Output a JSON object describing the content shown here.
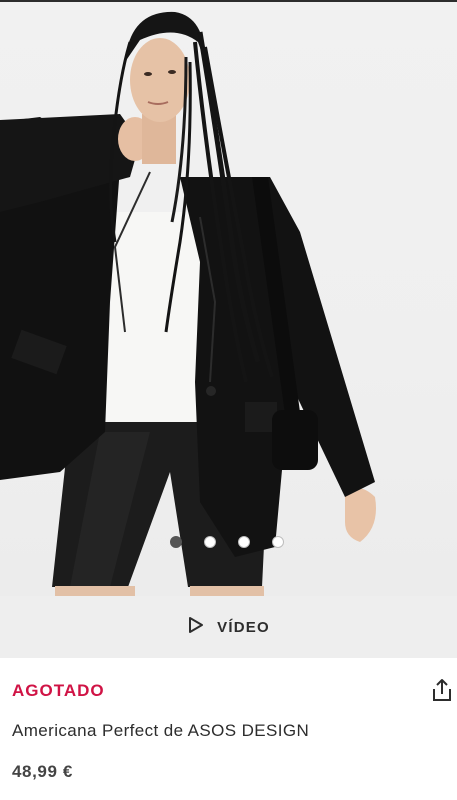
{
  "product": {
    "status": "AGOTADO",
    "title": "Americana Perfect de ASOS DESIGN",
    "price": "48,99 €"
  },
  "gallery": {
    "dot_count": 4,
    "active_index": 0,
    "video_label": "VÍDEO"
  },
  "icons": {
    "video": "play-triangle-icon",
    "share": "share-upload-icon"
  },
  "colors": {
    "status": "#d01345",
    "text": "#2d2d2d",
    "video_bar_bg": "#eeeeee"
  }
}
